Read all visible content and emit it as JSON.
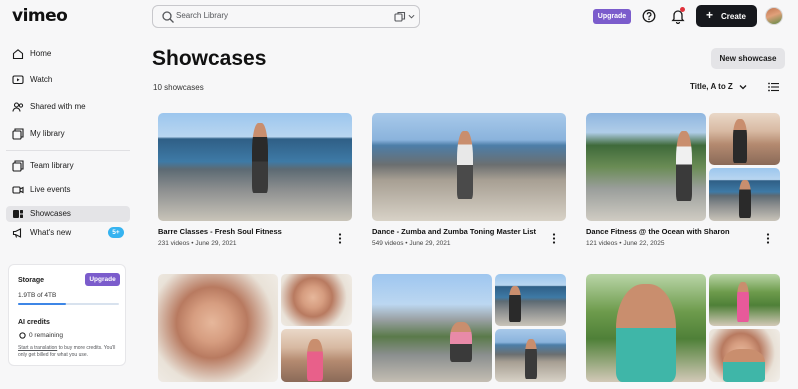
{
  "app": {
    "logo": "vimeo",
    "search_placeholder": "Search Library",
    "upgrade_label": "Upgrade",
    "create_label": "Create"
  },
  "sidebar": {
    "items": [
      {
        "label": "Home",
        "icon": "home-icon"
      },
      {
        "label": "Watch",
        "icon": "watch-icon"
      },
      {
        "label": "Shared with me",
        "icon": "people-icon"
      },
      {
        "label": "My library",
        "icon": "library-icon"
      },
      {
        "label": "Team library",
        "icon": "team-library-icon"
      },
      {
        "label": "Live events",
        "icon": "camera-icon"
      },
      {
        "label": "Showcases",
        "icon": "showcase-icon"
      },
      {
        "label": "What's new",
        "icon": "megaphone-icon"
      }
    ],
    "whats_new_badge": "5+",
    "active_item": "Showcases",
    "storage": {
      "label": "Storage",
      "upgrade_label": "Upgrade",
      "used": "1.9TB of 4TB",
      "used_fraction": 0.475,
      "ai_label": "AI credits",
      "ai_remaining": "0 remaining",
      "ai_note_link": "Start a translation",
      "ai_note_rest": " to buy more credits. You'll only get billed for what you use."
    }
  },
  "main": {
    "title": "Showcases",
    "count": "10 showcases",
    "new_button": "New showcase",
    "sort_label": "Title, A to Z",
    "showcases": [
      {
        "title": "Barre Classes - Fresh Soul Fitness",
        "meta": "231 videos • June 29, 2021"
      },
      {
        "title": "Dance - Zumba and Zumba Toning Master List",
        "meta": "549 videos • June 29, 2021"
      },
      {
        "title": "Dance Fitness @ the Ocean with Sharon",
        "meta": "121 videos • June 22, 2025"
      }
    ]
  },
  "colors": {
    "accent_purple": "#7b5ccc",
    "create_button": "#16181d",
    "badge_blue": "#36b3f0",
    "progress_blue": "#3d86e6"
  }
}
